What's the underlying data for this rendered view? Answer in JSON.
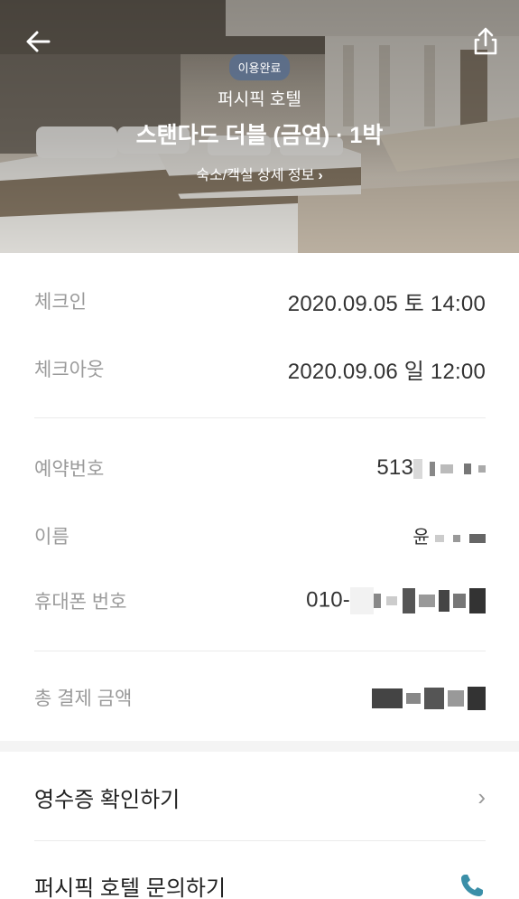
{
  "header": {
    "status_badge": "이용완료",
    "hotel_name": "퍼시픽 호텔",
    "room_name": "스탠다드 더블 (금연) · 1박",
    "detail_link": "숙소/객실 상세 정보",
    "detail_chevron": "›",
    "icons": {
      "back": "back-arrow-icon",
      "share": "share-icon"
    }
  },
  "stay": {
    "checkin_label": "체크인",
    "checkin_value": "2020.09.05 토 14:00",
    "checkout_label": "체크아웃",
    "checkout_value": "2020.09.06 일 12:00"
  },
  "reservation": {
    "number_label": "예약번호",
    "number_value_prefix": "513",
    "name_label": "이름",
    "name_value_prefix": "윤",
    "phone_label": "휴대폰 번호",
    "phone_value_prefix": "010-",
    "total_label": "총 결제 금액"
  },
  "actions": {
    "receipt_label": "영수증 확인하기",
    "receipt_chevron": "›",
    "inquiry_label": "퍼시픽 호텔 문의하기",
    "inquiry_icon": "phone-icon"
  },
  "colors": {
    "badge": "#5a6e8c",
    "label": "#9a9a9a",
    "accent_phone": "#3b8fa8"
  }
}
